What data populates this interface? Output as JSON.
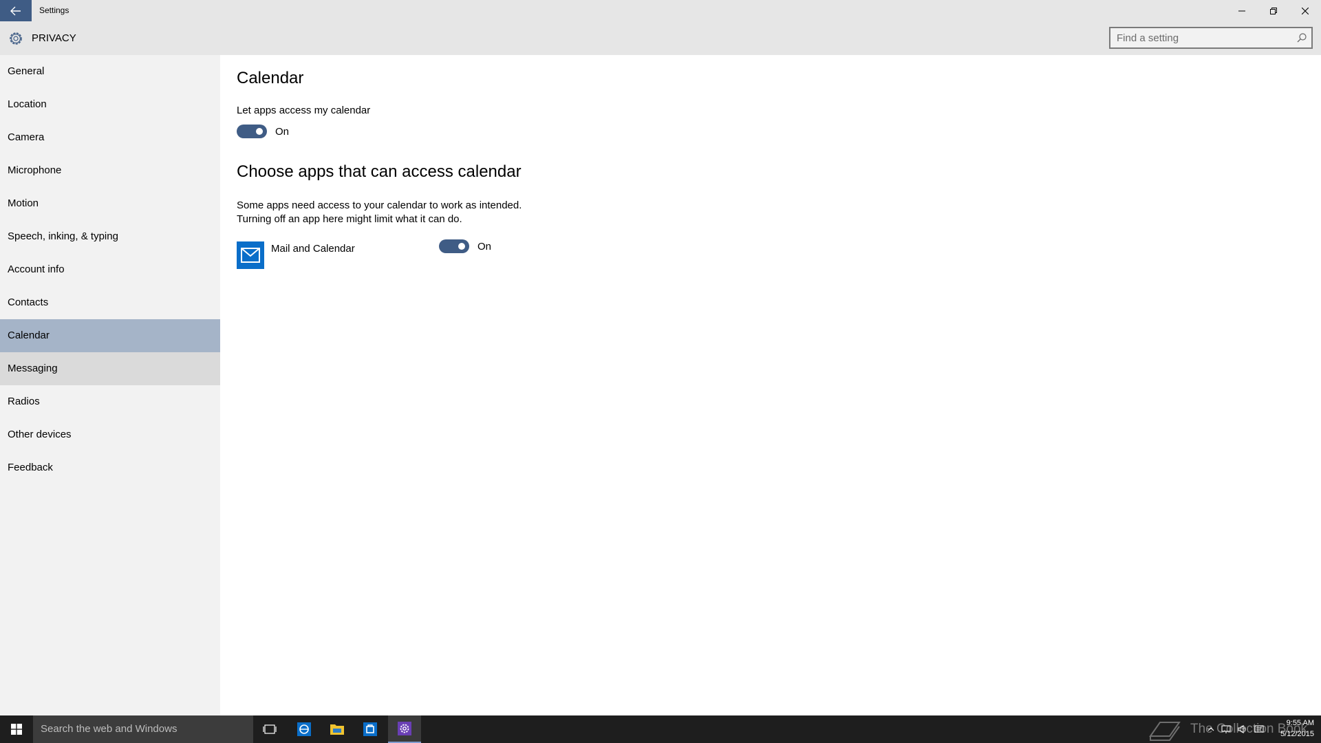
{
  "window": {
    "title": "Settings"
  },
  "header": {
    "title": "PRIVACY",
    "search_placeholder": "Find a setting"
  },
  "sidebar": {
    "items": [
      {
        "label": "General"
      },
      {
        "label": "Location"
      },
      {
        "label": "Camera"
      },
      {
        "label": "Microphone"
      },
      {
        "label": "Motion"
      },
      {
        "label": "Speech, inking, & typing"
      },
      {
        "label": "Account info"
      },
      {
        "label": "Contacts"
      },
      {
        "label": "Calendar",
        "state": "selected"
      },
      {
        "label": "Messaging",
        "state": "hover"
      },
      {
        "label": "Radios"
      },
      {
        "label": "Other devices"
      },
      {
        "label": "Feedback"
      }
    ]
  },
  "main": {
    "title": "Calendar",
    "access_label": "Let apps access my calendar",
    "access_toggle": "On",
    "choose_title": "Choose apps that can access calendar",
    "description_line1": "Some apps need access to your calendar to work as intended.",
    "description_line2": "Turning off an app here might limit what it can do.",
    "apps": [
      {
        "name": "Mail and Calendar",
        "toggle": "On"
      }
    ]
  },
  "taskbar": {
    "search_text": "Search the web and Windows",
    "watermark": "The Collection Book",
    "time": "9:55 AM",
    "date": "5/12/2015"
  },
  "colors": {
    "accent": "#3f5c85",
    "selected_nav": "#a5b4c8",
    "hover_nav": "#dadada",
    "sidebar_bg": "#f2f2f2",
    "titlebar_bg": "#e6e6e6",
    "taskbar_bg": "#1e1e1e",
    "mail_icon_bg": "#0a6ec9"
  },
  "icons": [
    "back-arrow-icon",
    "minimize-icon",
    "restore-icon",
    "close-icon",
    "gear-icon",
    "search-icon",
    "mail-icon",
    "windows-logo-icon",
    "task-view-icon",
    "edge-icon",
    "file-explorer-icon",
    "store-icon",
    "settings-icon"
  ]
}
